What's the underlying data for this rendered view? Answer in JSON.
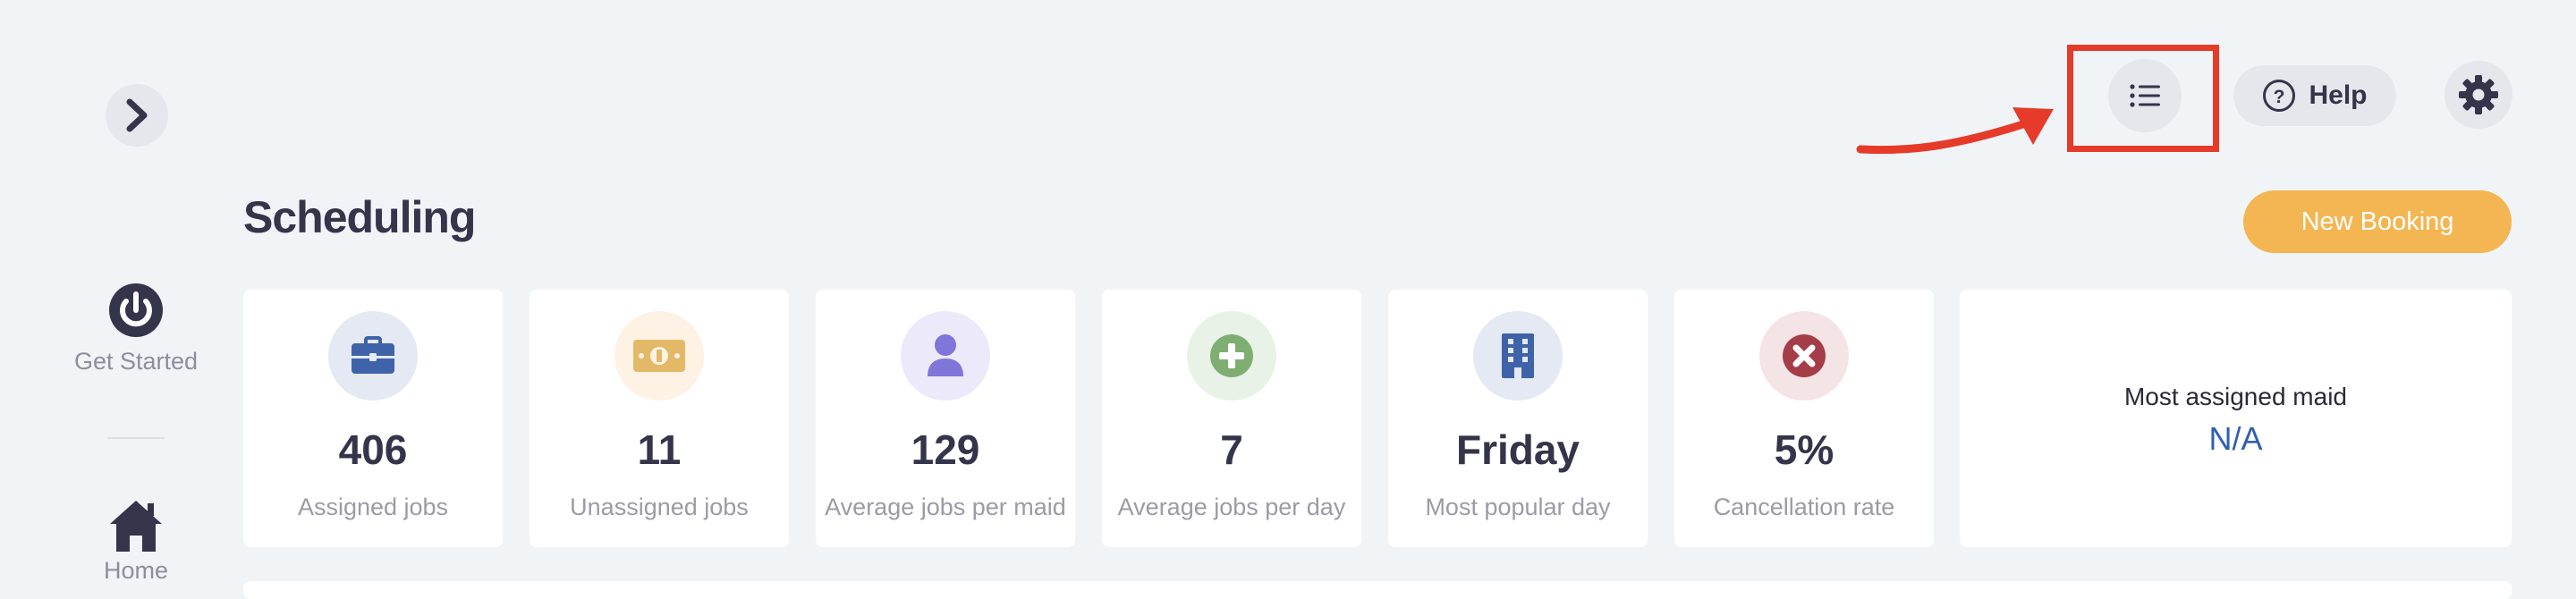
{
  "sidebar": {
    "items": [
      {
        "label": "Get Started",
        "icon": "power-icon"
      },
      {
        "label": "Home",
        "icon": "home-icon"
      }
    ]
  },
  "topbar": {
    "help_label": "Help"
  },
  "page": {
    "title": "Scheduling",
    "new_booking_label": "New Booking"
  },
  "stats": [
    {
      "value": "406",
      "label": "Assigned jobs",
      "icon": "briefcase-icon",
      "icon_bg": "#e4e9f3",
      "icon_color": "#3f63a8"
    },
    {
      "value": "11",
      "label": "Unassigned jobs",
      "icon": "money-icon",
      "icon_bg": "#fdf2e4",
      "icon_color": "#e3b866"
    },
    {
      "value": "129",
      "label": "Average jobs per maid",
      "icon": "user-icon",
      "icon_bg": "#ece9fb",
      "icon_color": "#8075d8"
    },
    {
      "value": "7",
      "label": "Average jobs per day",
      "icon": "plus-circle-icon",
      "icon_bg": "#e9f2e6",
      "icon_color": "#7fae72"
    },
    {
      "value": "Friday",
      "label": "Most popular day",
      "icon": "building-icon",
      "icon_bg": "#e4e9f3",
      "icon_color": "#3f63a8"
    },
    {
      "value": "5%",
      "label": "Cancellation rate",
      "icon": "x-circle-icon",
      "icon_bg": "#f5e4e6",
      "icon_color": "#a53d48"
    }
  ],
  "most_assigned": {
    "label": "Most assigned maid",
    "value": "N/A"
  },
  "colors": {
    "accent": "#f4b652",
    "highlight": "#e63b2a",
    "link": "#2f5fb0"
  }
}
